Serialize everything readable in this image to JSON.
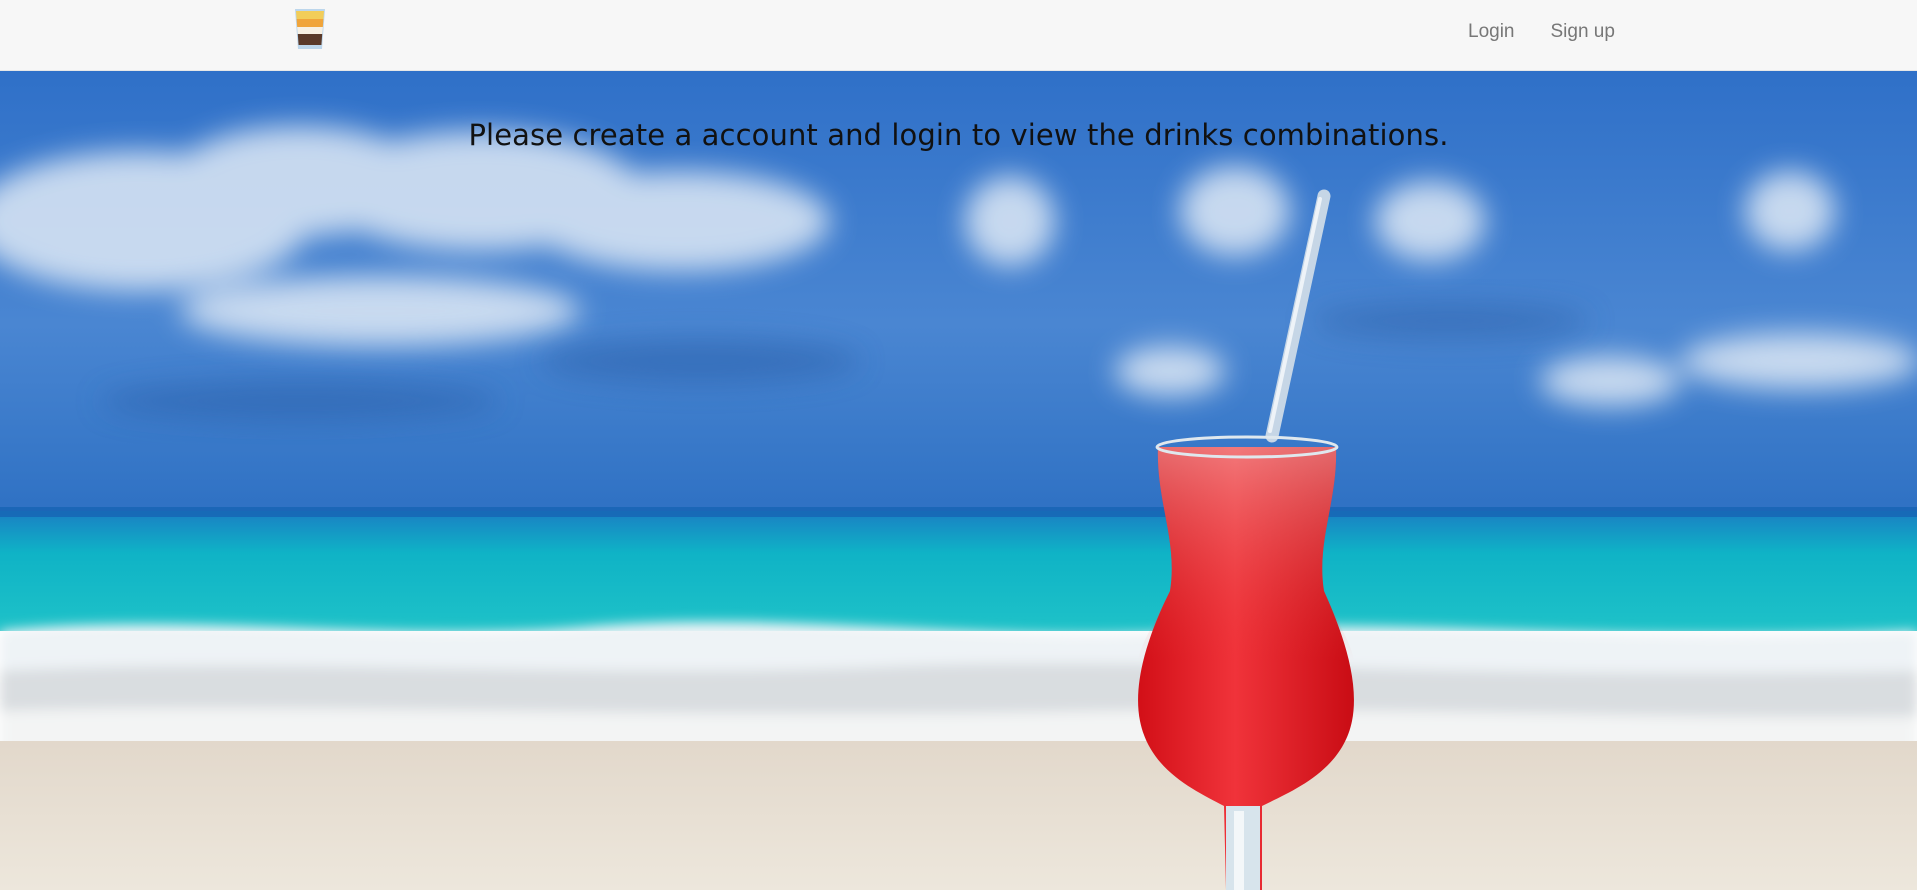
{
  "navbar": {
    "logo_icon": "layered-shot-glass-icon",
    "links": [
      {
        "label": "Login"
      },
      {
        "label": "Sign up"
      }
    ]
  },
  "hero": {
    "message": "Please create a account and login to view the drinks combinations.",
    "background": "beach-cocktail-photo",
    "colors": {
      "sky": "#3a78d0",
      "sea": "#12b6c8",
      "sand": "#e6e0d6",
      "drink": "#e5141a"
    }
  }
}
